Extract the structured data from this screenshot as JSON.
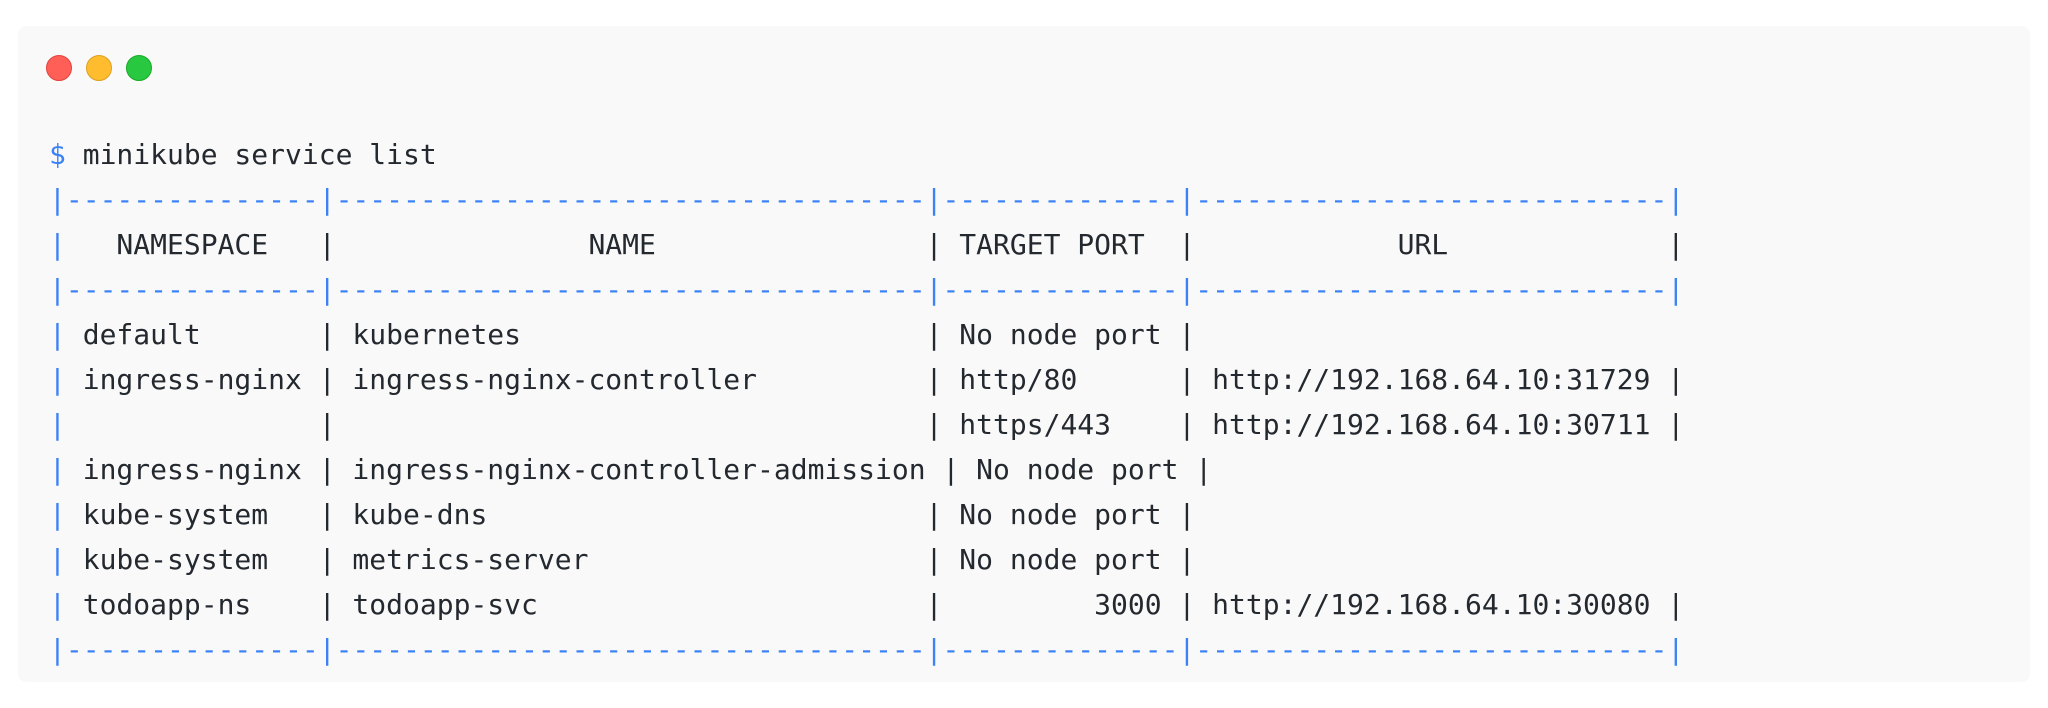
{
  "window": {
    "buttons": [
      "close",
      "minimize",
      "maximize"
    ]
  },
  "terminal": {
    "prompt": "$",
    "command": " minikube service list",
    "separator": "|---------------|-----------------------------------|--------------|----------------------------|",
    "lines": [
      "|   NAMESPACE   |               NAME                | TARGET PORT  |            URL             |",
      "| default       | kubernetes                        | No node port |",
      "| ingress-nginx | ingress-nginx-controller          | http/80      | http://192.168.64.10:31729 |",
      "|               |                                   | https/443    | http://192.168.64.10:30711 |",
      "| ingress-nginx | ingress-nginx-controller-admission | No node port |",
      "| kube-system   | kube-dns                          | No node port |",
      "| kube-system   | metrics-server                    | No node port |",
      "| todoapp-ns    | todoapp-svc                       |         3000 | http://192.168.64.10:30080 |"
    ]
  },
  "colors": {
    "accent": "#3b82f6",
    "text": "#24292f",
    "background": "#f9f9f9"
  }
}
